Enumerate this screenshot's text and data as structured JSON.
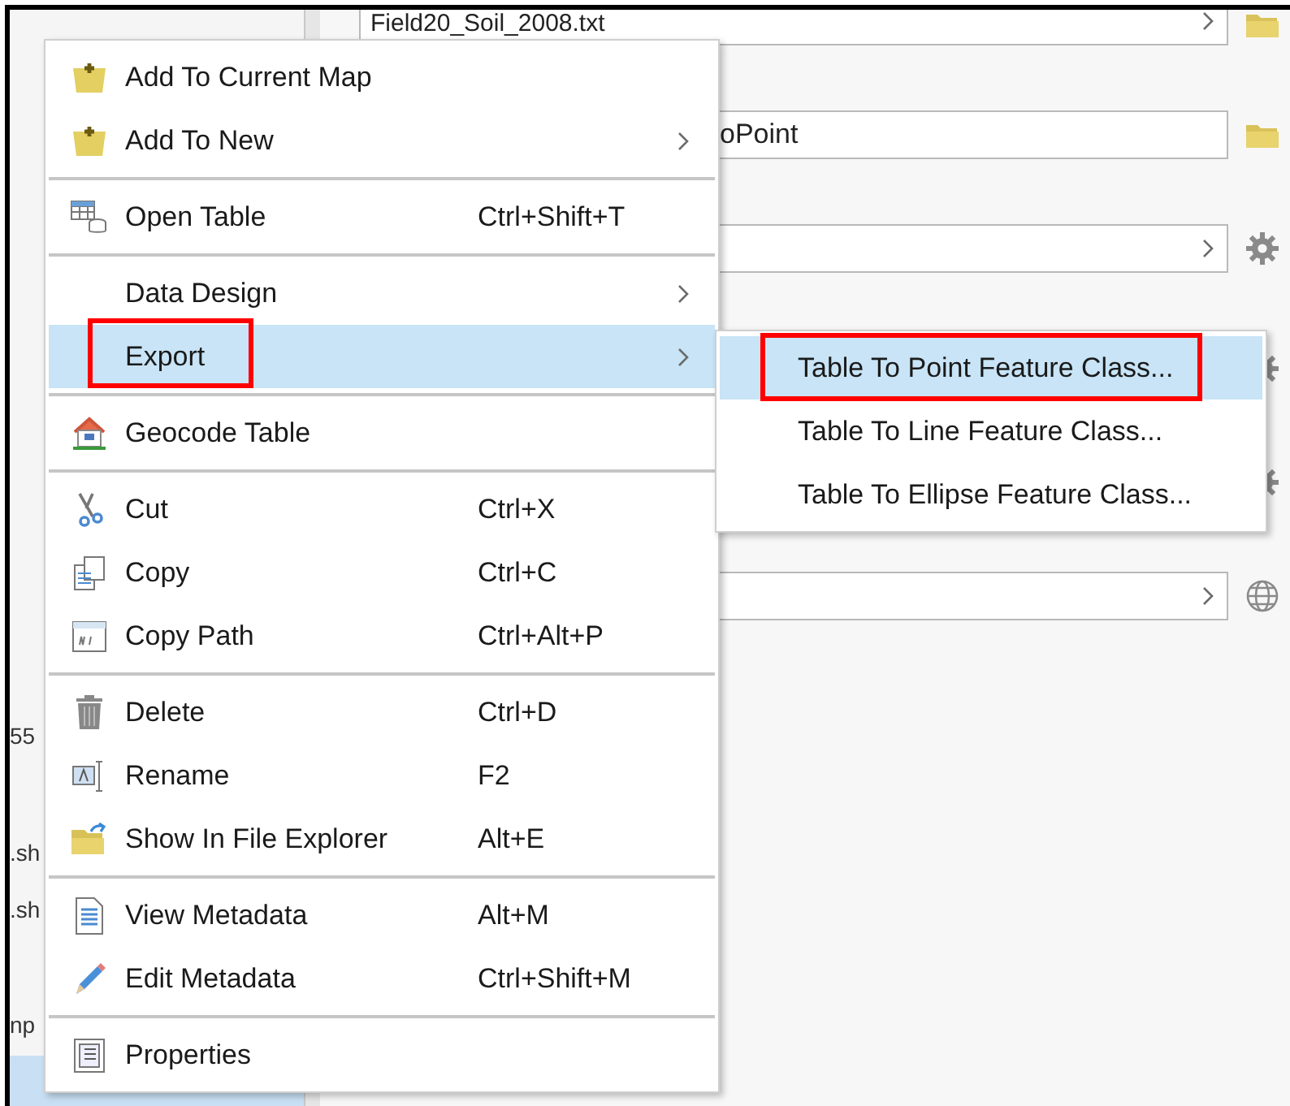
{
  "left_pane": {
    "rows": [
      {
        "text": "55"
      },
      {
        "text": ".sh"
      },
      {
        "text": ".sh"
      },
      {
        "text": "np"
      }
    ]
  },
  "tool_panel": {
    "fields": [
      {
        "kind": "dropdown",
        "value": "Field20_Soil_2008.txt"
      },
      {
        "kind": "text",
        "value": "oPoint"
      },
      {
        "kind": "dropdown"
      },
      {
        "kind": "dropdown"
      }
    ]
  },
  "context_menu": {
    "groups": [
      [
        {
          "label": "Add To Current Map",
          "submenu": false,
          "selected": false,
          "framed": false
        },
        {
          "label": "Add To New",
          "submenu": true,
          "selected": false,
          "framed": false
        }
      ],
      [
        {
          "label": "Open Table",
          "shortcut": "Ctrl+Shift+T",
          "submenu": false,
          "selected": false,
          "framed": false
        }
      ],
      [
        {
          "label": "Data Design",
          "submenu": true,
          "selected": false,
          "framed": false
        },
        {
          "label": "Export",
          "submenu": true,
          "selected": true,
          "framed": true
        }
      ],
      [
        {
          "label": "Geocode Table",
          "submenu": false,
          "selected": false,
          "framed": false
        }
      ],
      [
        {
          "label": "Cut",
          "shortcut": "Ctrl+X",
          "submenu": false,
          "selected": false,
          "framed": false
        },
        {
          "label": "Copy",
          "shortcut": "Ctrl+C",
          "submenu": false,
          "selected": false,
          "framed": false
        },
        {
          "label": "Copy Path",
          "shortcut": "Ctrl+Alt+P",
          "submenu": false,
          "selected": false,
          "framed": false
        }
      ],
      [
        {
          "label": "Delete",
          "shortcut": "Ctrl+D",
          "submenu": false,
          "selected": false,
          "framed": false
        },
        {
          "label": "Rename",
          "shortcut": "F2",
          "submenu": false,
          "selected": false,
          "framed": false
        },
        {
          "label": "Show In File Explorer",
          "shortcut": "Alt+E",
          "submenu": false,
          "selected": false,
          "framed": false
        }
      ],
      [
        {
          "label": "View Metadata",
          "shortcut": "Alt+M",
          "submenu": false,
          "selected": false,
          "framed": false
        },
        {
          "label": "Edit Metadata",
          "shortcut": "Ctrl+Shift+M",
          "submenu": false,
          "selected": false,
          "framed": false
        }
      ],
      [
        {
          "label": "Properties",
          "submenu": false,
          "selected": false,
          "framed": false
        }
      ]
    ]
  },
  "export_submenu": {
    "items": [
      {
        "label": "Table To Point Feature Class...",
        "selected": true,
        "framed": true
      },
      {
        "label": "Table To Line Feature Class...",
        "selected": false,
        "framed": false
      },
      {
        "label": "Table To Ellipse Feature Class...",
        "selected": false,
        "framed": false
      }
    ]
  }
}
